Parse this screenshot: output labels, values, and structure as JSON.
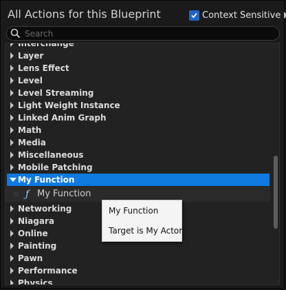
{
  "header": {
    "title": "All Actions for this Blueprint",
    "context_sensitive": {
      "label": "Context Sensitive",
      "checked": true
    }
  },
  "search": {
    "placeholder": "Search",
    "value": ""
  },
  "categories_top": [
    "Interchange",
    "Layer",
    "Lens Effect",
    "Level",
    "Level Streaming",
    "Light Weight Instance",
    "Linked Anim Graph",
    "Math",
    "Media",
    "Miscellaneous",
    "Mobile Patching"
  ],
  "expanded_category": {
    "label": "My Function",
    "expanded": true,
    "children": [
      {
        "label": "My Function",
        "icon": "function-icon"
      }
    ]
  },
  "categories_bottom": [
    "Networking",
    "Niagara",
    "Online",
    "Painting",
    "Pawn",
    "Performance",
    "Physics"
  ],
  "tooltip": {
    "line1": "My Function",
    "line2": "Target is My Actor"
  },
  "colors": {
    "selection": "#0f7ae0",
    "checkbox": "#1f64c7",
    "background": "#1a1a1a"
  }
}
